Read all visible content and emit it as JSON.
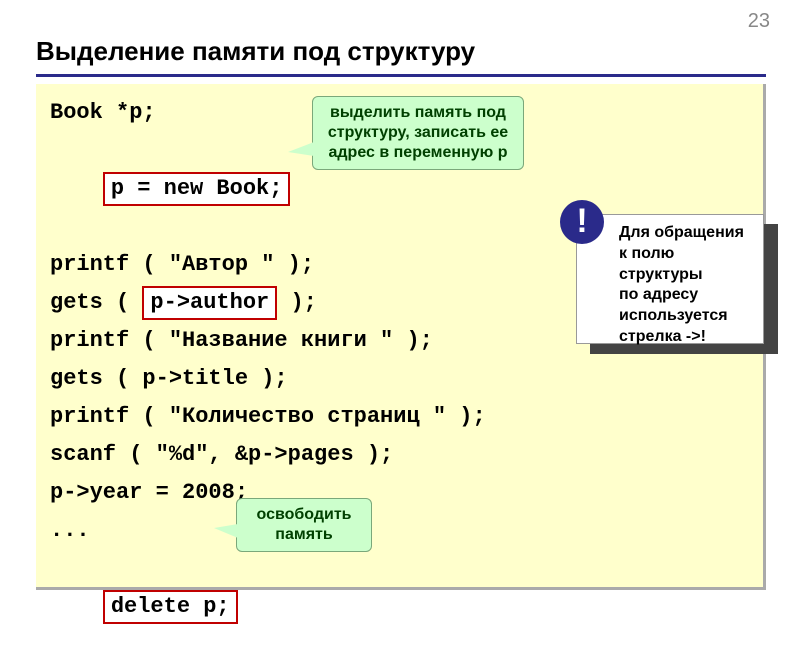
{
  "page_number": "23",
  "title": "Выделение памяти под структуру",
  "code": {
    "l1": "Book *p;",
    "l2_box": "p = new Book;",
    "l3": "printf ( \"Автор \" );",
    "l4_pre": "gets ( ",
    "l4_box": "p->author",
    "l4_post": " );",
    "l5": "printf ( \"Название книги \" );",
    "l6": "gets ( p->title );",
    "l7": "printf ( \"Количество страниц \" );",
    "l8": "scanf ( \"%d\", &p->pages );",
    "l9": "p->year = 2008;",
    "l10": "...",
    "l11_box": "delete p;"
  },
  "callout1": {
    "line1": "выделить память под",
    "line2": "структуру, записать ее",
    "line3": "адрес в переменную p"
  },
  "callout2": {
    "line1": "освободить",
    "line2": "память"
  },
  "note": {
    "icon": "!",
    "line1": "Для обращения",
    "line2": "к полю структуры",
    "line3": "по адресу",
    "line4": "используется",
    "line5": "стрелка ->!"
  }
}
